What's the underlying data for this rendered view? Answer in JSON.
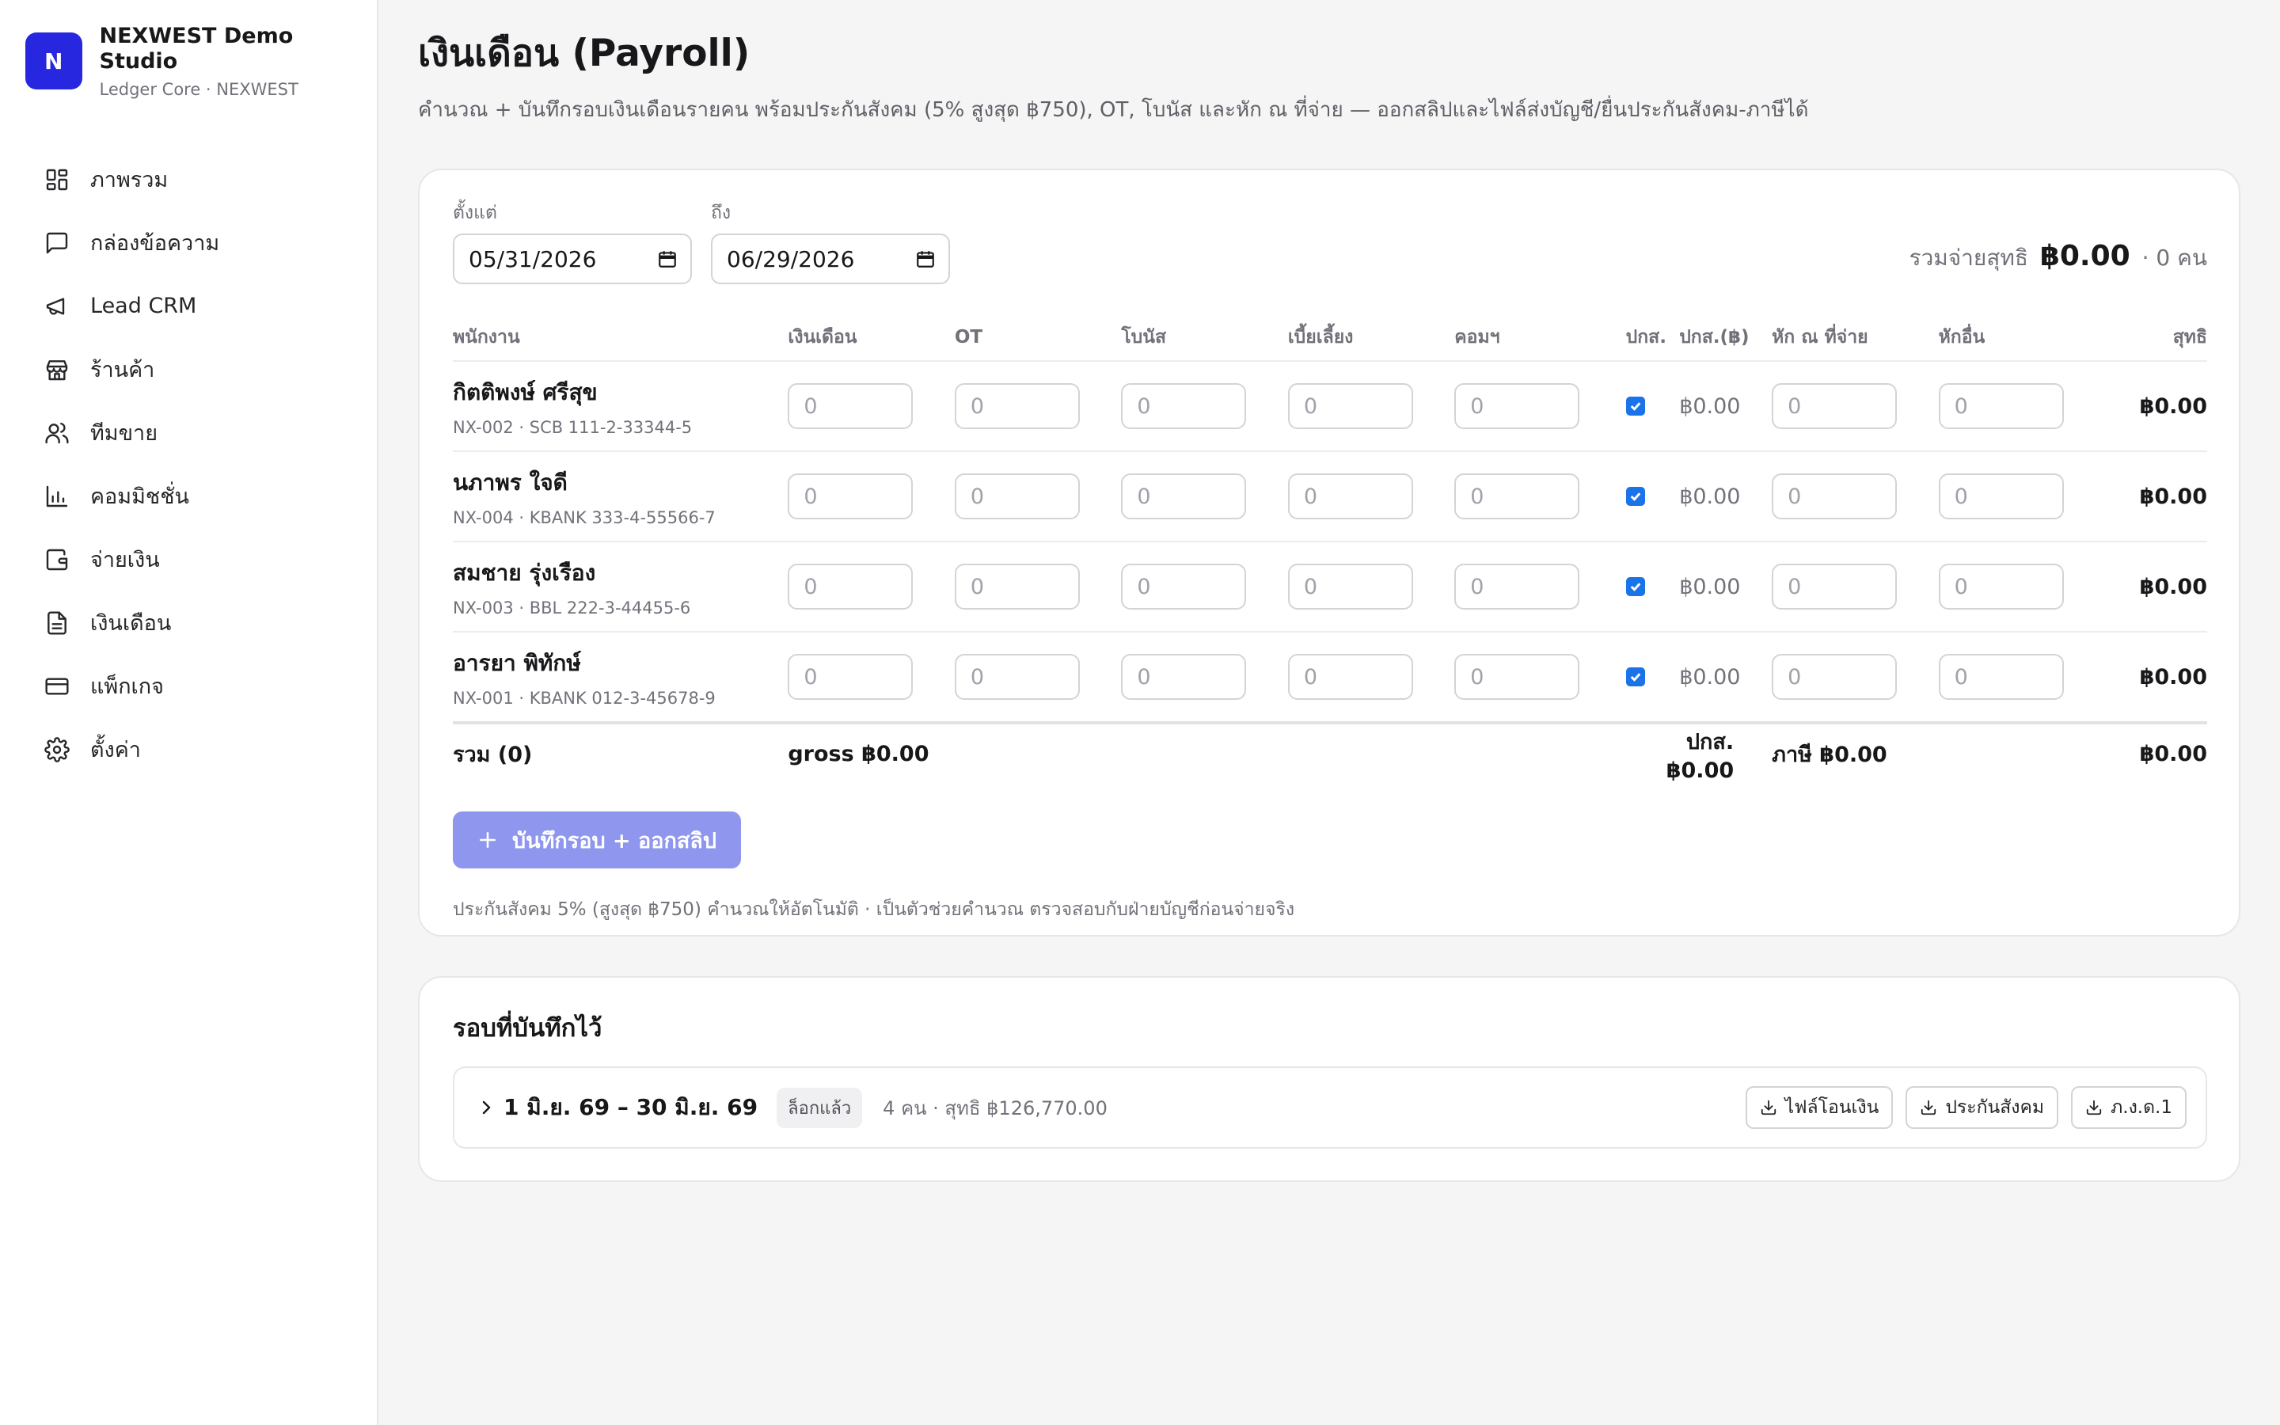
{
  "brand": {
    "logo_letter": "N",
    "name": "NEXWEST Demo Studio",
    "subtitle": "Ledger Core · NEXWEST"
  },
  "sidebar": {
    "items": [
      {
        "label": "ภาพรวม",
        "icon": "dashboard-icon"
      },
      {
        "label": "กล่องข้อความ",
        "icon": "message-icon"
      },
      {
        "label": "Lead CRM",
        "icon": "megaphone-icon"
      },
      {
        "label": "ร้านค้า",
        "icon": "store-icon"
      },
      {
        "label": "ทีมขาย",
        "icon": "users-icon"
      },
      {
        "label": "คอมมิชชั่น",
        "icon": "bar-chart-icon"
      },
      {
        "label": "จ่ายเงิน",
        "icon": "wallet-icon"
      },
      {
        "label": "เงินเดือน",
        "icon": "document-icon"
      },
      {
        "label": "แพ็กเกจ",
        "icon": "credit-card-icon"
      },
      {
        "label": "ตั้งค่า",
        "icon": "gear-icon"
      }
    ]
  },
  "page": {
    "title": "เงินเดือน (Payroll)",
    "subtitle": "คำนวณ + บันทึกรอบเงินเดือนรายคน พร้อมประกันสังคม (5% สูงสุด ฿750), OT, โบนัส และหัก ณ ที่จ่าย — ออกสลิปและไฟล์ส่งบัญชี/ยื่นประกันสังคม-ภาษีได้"
  },
  "filters": {
    "from_label": "ตั้งแต่",
    "from_value": "05/31/2026",
    "to_label": "ถึง",
    "to_value": "06/29/2026"
  },
  "summary": {
    "label": "รวมจ่ายสุทธิ",
    "amount": "฿0.00",
    "count": "· 0 คน"
  },
  "table": {
    "headers": {
      "employee": "พนักงาน",
      "salary": "เงินเดือน",
      "ot": "OT",
      "bonus": "โบนัส",
      "allowance": "เบี้ยเลี้ยง",
      "commission": "คอมฯ",
      "sso": "ปกส.",
      "sso_amount": "ปกส.(฿)",
      "wht": "หัก ณ ที่จ่าย",
      "other_deduct": "หักอื่น",
      "net": "สุทธิ"
    },
    "rows": [
      {
        "name": "กิตติพงษ์ ศรีสุข",
        "meta": "NX-002 · SCB 111-2-33344-5",
        "salary": "0",
        "ot": "0",
        "bonus": "0",
        "allowance": "0",
        "commission": "0",
        "sso_amount": "฿0.00",
        "wht": "0",
        "other": "0",
        "net": "฿0.00"
      },
      {
        "name": "นภาพร ใจดี",
        "meta": "NX-004 · KBANK 333-4-55566-7",
        "salary": "0",
        "ot": "0",
        "bonus": "0",
        "allowance": "0",
        "commission": "0",
        "sso_amount": "฿0.00",
        "wht": "0",
        "other": "0",
        "net": "฿0.00"
      },
      {
        "name": "สมชาย รุ่งเรือง",
        "meta": "NX-003 · BBL 222-3-44455-6",
        "salary": "0",
        "ot": "0",
        "bonus": "0",
        "allowance": "0",
        "commission": "0",
        "sso_amount": "฿0.00",
        "wht": "0",
        "other": "0",
        "net": "฿0.00"
      },
      {
        "name": "อารยา พิทักษ์",
        "meta": "NX-001 · KBANK 012-3-45678-9",
        "salary": "0",
        "ot": "0",
        "bonus": "0",
        "allowance": "0",
        "commission": "0",
        "sso_amount": "฿0.00",
        "wht": "0",
        "other": "0",
        "net": "฿0.00"
      }
    ],
    "totals": {
      "label": "รวม (0)",
      "gross": "gross ฿0.00",
      "sso": "ปกส. ฿0.00",
      "tax": "ภาษี ฿0.00",
      "net": "฿0.00"
    }
  },
  "actions": {
    "save_label": "บันทึกรอบ + ออกสลิป"
  },
  "footnote": "ประกันสังคม 5% (สูงสุด ฿750) คำนวณให้อัตโนมัติ · เป็นตัวช่วยคำนวณ ตรวจสอบกับฝ่ายบัญชีก่อนจ่ายจริง",
  "saved": {
    "title": "รอบที่บันทึกไว้",
    "period": {
      "label": "1 มิ.ย. 69 – 30 มิ.ย. 69",
      "badge": "ล็อกแล้ว",
      "meta": "4 คน · สุทธิ ฿126,770.00",
      "buttons": [
        "ไฟล์โอนเงิน",
        "ประกันสังคม",
        "ภ.ง.ด.1"
      ]
    }
  },
  "colors": {
    "brand": "#2727e0",
    "primary_button": "#8f96ee",
    "checkbox": "#1a73e8"
  }
}
